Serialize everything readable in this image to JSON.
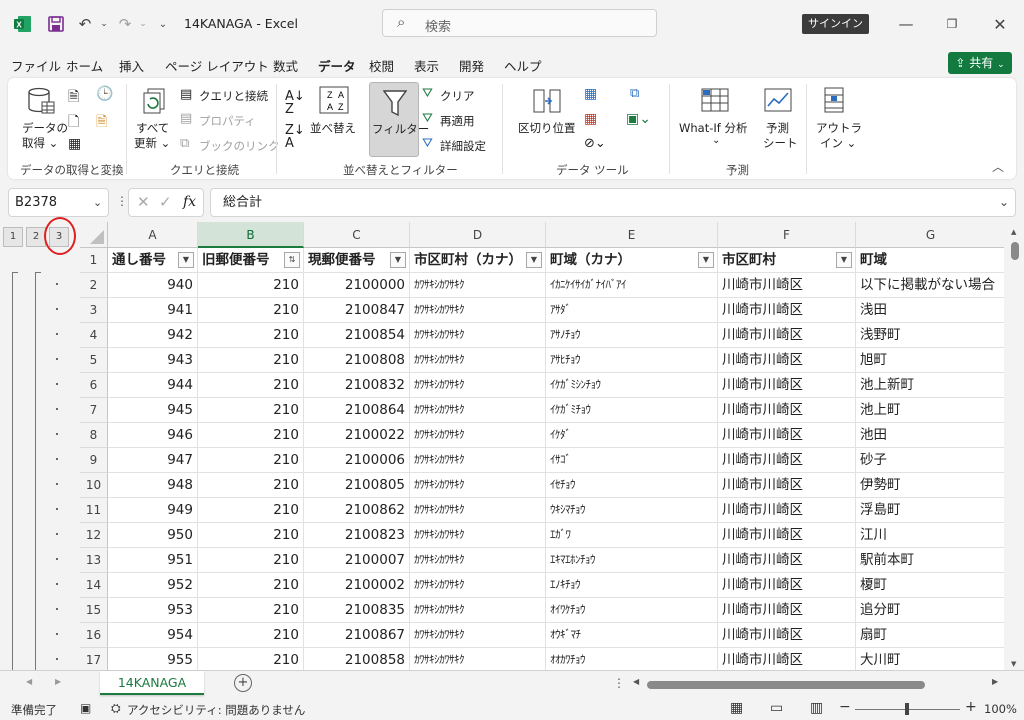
{
  "titlebar": {
    "title": "14KANAGA  -  Excel",
    "search_placeholder": "検索",
    "signin_label": "サインイン"
  },
  "menu": {
    "items": [
      "ファイル",
      "ホーム",
      "挿入",
      "ページ レイアウト",
      "数式",
      "データ",
      "校閲",
      "表示",
      "開発",
      "ヘルプ"
    ],
    "active": "データ",
    "share_label": "共有"
  },
  "ribbon": {
    "get_data_label_1": "データの",
    "get_data_label_2": "取得",
    "refresh_label_1": "すべて",
    "refresh_label_2": "更新",
    "queries_label": "クエリと接続",
    "properties_label": "プロパティ",
    "editlinks_label": "ブックのリンク",
    "sort_label": "並べ替え",
    "filter_label": "フィルター",
    "clear_label": "クリア",
    "reapply_label": "再適用",
    "advanced_label": "詳細設定",
    "text_to_columns_label": "区切り位置",
    "whatif_label": "What-If 分析",
    "forecast_label_1": "予測",
    "forecast_label_2": "シート",
    "outline_label_1": "アウトラ",
    "outline_label_2": "イン",
    "groups": [
      "データの取得と変換",
      "クエリと接続",
      "並べ替えとフィルター",
      "データ ツール",
      "予測"
    ]
  },
  "formula_bar": {
    "name_box": "B2378",
    "formula": "総合計"
  },
  "outline_levels": [
    "1",
    "2",
    "3"
  ],
  "columns": [
    "A",
    "B",
    "C",
    "D",
    "E",
    "F",
    "G"
  ],
  "selected_column": "B",
  "header_row": [
    "通し番号",
    "旧郵便番号",
    "現郵便番号",
    "市区町村（カナ）",
    "町域（カナ）",
    "市区町村",
    "町域"
  ],
  "rows": [
    {
      "n": "2",
      "cells": [
        "940",
        "210",
        "2100000",
        "ｶﾜｻｷｼｶﾜｻｷｸ",
        "ｲｶﾆｹｲｻｲｶﾞﾅｲﾊﾞｱｲ",
        "川崎市川崎区",
        "以下に掲載がない場合"
      ]
    },
    {
      "n": "3",
      "cells": [
        "941",
        "210",
        "2100847",
        "ｶﾜｻｷｼｶﾜｻｷｸ",
        "ｱｻﾀﾞ",
        "川崎市川崎区",
        "浅田"
      ]
    },
    {
      "n": "4",
      "cells": [
        "942",
        "210",
        "2100854",
        "ｶﾜｻｷｼｶﾜｻｷｸ",
        "ｱｻﾉﾁｮｳ",
        "川崎市川崎区",
        "浅野町"
      ]
    },
    {
      "n": "5",
      "cells": [
        "943",
        "210",
        "2100808",
        "ｶﾜｻｷｼｶﾜｻｷｸ",
        "ｱｻﾋﾁｮｳ",
        "川崎市川崎区",
        "旭町"
      ]
    },
    {
      "n": "6",
      "cells": [
        "944",
        "210",
        "2100832",
        "ｶﾜｻｷｼｶﾜｻｷｸ",
        "ｲｹｶﾞﾐｼﾝﾁｮｳ",
        "川崎市川崎区",
        "池上新町"
      ]
    },
    {
      "n": "7",
      "cells": [
        "945",
        "210",
        "2100864",
        "ｶﾜｻｷｼｶﾜｻｷｸ",
        "ｲｹｶﾞﾐﾁｮｳ",
        "川崎市川崎区",
        "池上町"
      ]
    },
    {
      "n": "8",
      "cells": [
        "946",
        "210",
        "2100022",
        "ｶﾜｻｷｼｶﾜｻｷｸ",
        "ｲｹﾀﾞ",
        "川崎市川崎区",
        "池田"
      ]
    },
    {
      "n": "9",
      "cells": [
        "947",
        "210",
        "2100006",
        "ｶﾜｻｷｼｶﾜｻｷｸ",
        "ｲｻｺﾞ",
        "川崎市川崎区",
        "砂子"
      ]
    },
    {
      "n": "10",
      "cells": [
        "948",
        "210",
        "2100805",
        "ｶﾜｻｷｼｶﾜｻｷｸ",
        "ｲｾﾁｮｳ",
        "川崎市川崎区",
        "伊勢町"
      ]
    },
    {
      "n": "11",
      "cells": [
        "949",
        "210",
        "2100862",
        "ｶﾜｻｷｼｶﾜｻｷｸ",
        "ｳｷｼﾏﾁｮｳ",
        "川崎市川崎区",
        "浮島町"
      ]
    },
    {
      "n": "12",
      "cells": [
        "950",
        "210",
        "2100823",
        "ｶﾜｻｷｼｶﾜｻｷｸ",
        "ｴｶﾞﾜ",
        "川崎市川崎区",
        "江川"
      ]
    },
    {
      "n": "13",
      "cells": [
        "951",
        "210",
        "2100007",
        "ｶﾜｻｷｼｶﾜｻｷｸ",
        "ｴｷﾏｴﾎﾝﾁｮｳ",
        "川崎市川崎区",
        "駅前本町"
      ]
    },
    {
      "n": "14",
      "cells": [
        "952",
        "210",
        "2100002",
        "ｶﾜｻｷｼｶﾜｻｷｸ",
        "ｴﾉｷﾁｮｳ",
        "川崎市川崎区",
        "榎町"
      ]
    },
    {
      "n": "15",
      "cells": [
        "953",
        "210",
        "2100835",
        "ｶﾜｻｷｼｶﾜｻｷｸ",
        "ｵｲﾜｹﾁｮｳ",
        "川崎市川崎区",
        "追分町"
      ]
    },
    {
      "n": "16",
      "cells": [
        "954",
        "210",
        "2100867",
        "ｶﾜｻｷｼｶﾜｻｷｸ",
        "ｵｳｷﾞﾏﾁ",
        "川崎市川崎区",
        "扇町"
      ]
    },
    {
      "n": "17",
      "cells": [
        "955",
        "210",
        "2100858",
        "ｶﾜｻｷｼｶﾜｻｷｸ",
        "ｵｵｶﾜﾁｮｳ",
        "川崎市川崎区",
        "大川町"
      ]
    }
  ],
  "sheet_tab": "14KANAGA",
  "status": {
    "ready": "準備完了",
    "accessibility": "アクセシビリティ: 問題ありません",
    "zoom": "100%"
  },
  "colors": {
    "excel_green": "#1b7a3e",
    "share_green": "#127a3f",
    "highlight_circle": "#e02020"
  }
}
